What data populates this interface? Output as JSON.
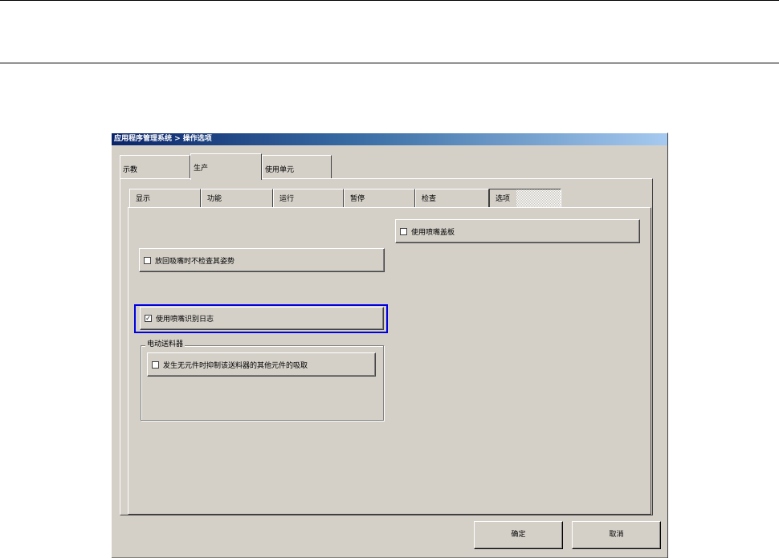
{
  "window": {
    "title": "应用程序管理系统 > 操作选项"
  },
  "main_tabs": [
    {
      "label": "示教",
      "active": false
    },
    {
      "label": "生产",
      "active": true
    },
    {
      "label": "使用单元",
      "active": false
    }
  ],
  "sub_tabs": [
    {
      "label": "显示",
      "active": false
    },
    {
      "label": "功能",
      "active": false
    },
    {
      "label": "运行",
      "active": false
    },
    {
      "label": "暂停",
      "active": false
    },
    {
      "label": "检查",
      "active": false
    },
    {
      "label": "选项",
      "active": true
    }
  ],
  "options": {
    "skip_posture_check": {
      "label": "放回吸嘴时不检查其姿势",
      "checked": false
    },
    "use_traceability_log": {
      "label": "使用喷嘴识别日志",
      "checked": true
    },
    "use_nozzle_cover": {
      "label": "使用喷嘴盖板",
      "checked": false
    }
  },
  "feeder_group": {
    "title": "电动送料器",
    "suppress_pickup": {
      "label": "发生无元件时抑制该送料器的其他元件的吸取",
      "checked": false
    }
  },
  "buttons": {
    "ok": "确定",
    "cancel": "取消"
  },
  "colors": {
    "highlight_border": "#0000e0",
    "titlebar_start": "#0a246a",
    "face": "#d4d0c8"
  }
}
